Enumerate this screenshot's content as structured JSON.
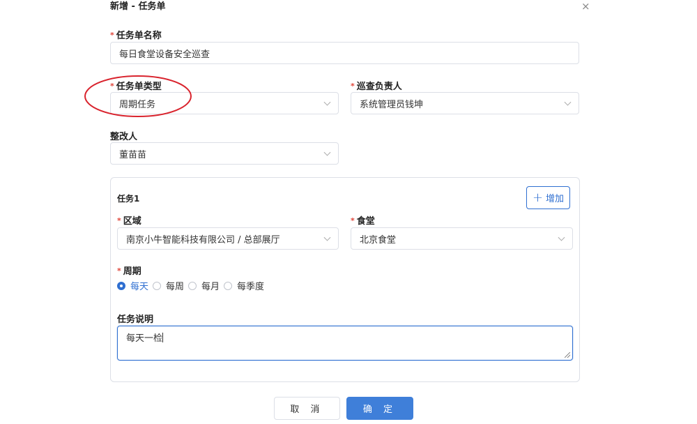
{
  "dialog": {
    "title": "新增 - 任务单",
    "close_icon": "×"
  },
  "form": {
    "required_mark": "*",
    "task_name": {
      "label": "任务单名称",
      "value": "每日食堂设备安全巡查"
    },
    "task_type": {
      "label": "任务单类型",
      "value": "周期任务"
    },
    "inspector": {
      "label": "巡查负责人",
      "value": "系统管理员钱坤"
    },
    "rectifier": {
      "label": "整改人",
      "value": "董苗苗"
    }
  },
  "task": {
    "title": "任务1",
    "add_button": {
      "icon": "+",
      "label": "增加"
    },
    "area": {
      "label": "区域",
      "value": "南京小牛智能科技有限公司 / 总部展厅"
    },
    "canteen": {
      "label": "食堂",
      "value": "北京食堂"
    },
    "period": {
      "label": "周期",
      "options": [
        "每天",
        "每周",
        "每月",
        "每季度"
      ],
      "selected": "每天"
    },
    "description": {
      "label": "任务说明",
      "value": "每天一检"
    }
  },
  "footer": {
    "cancel": "取 消",
    "confirm": "确 定"
  },
  "annotation": {
    "color": "#d9232d",
    "shape": "ellipse",
    "target": "task_type_label"
  },
  "colors": {
    "primary": "#2f6fd1",
    "required": "#e0453a",
    "border": "#dcdfe6"
  }
}
